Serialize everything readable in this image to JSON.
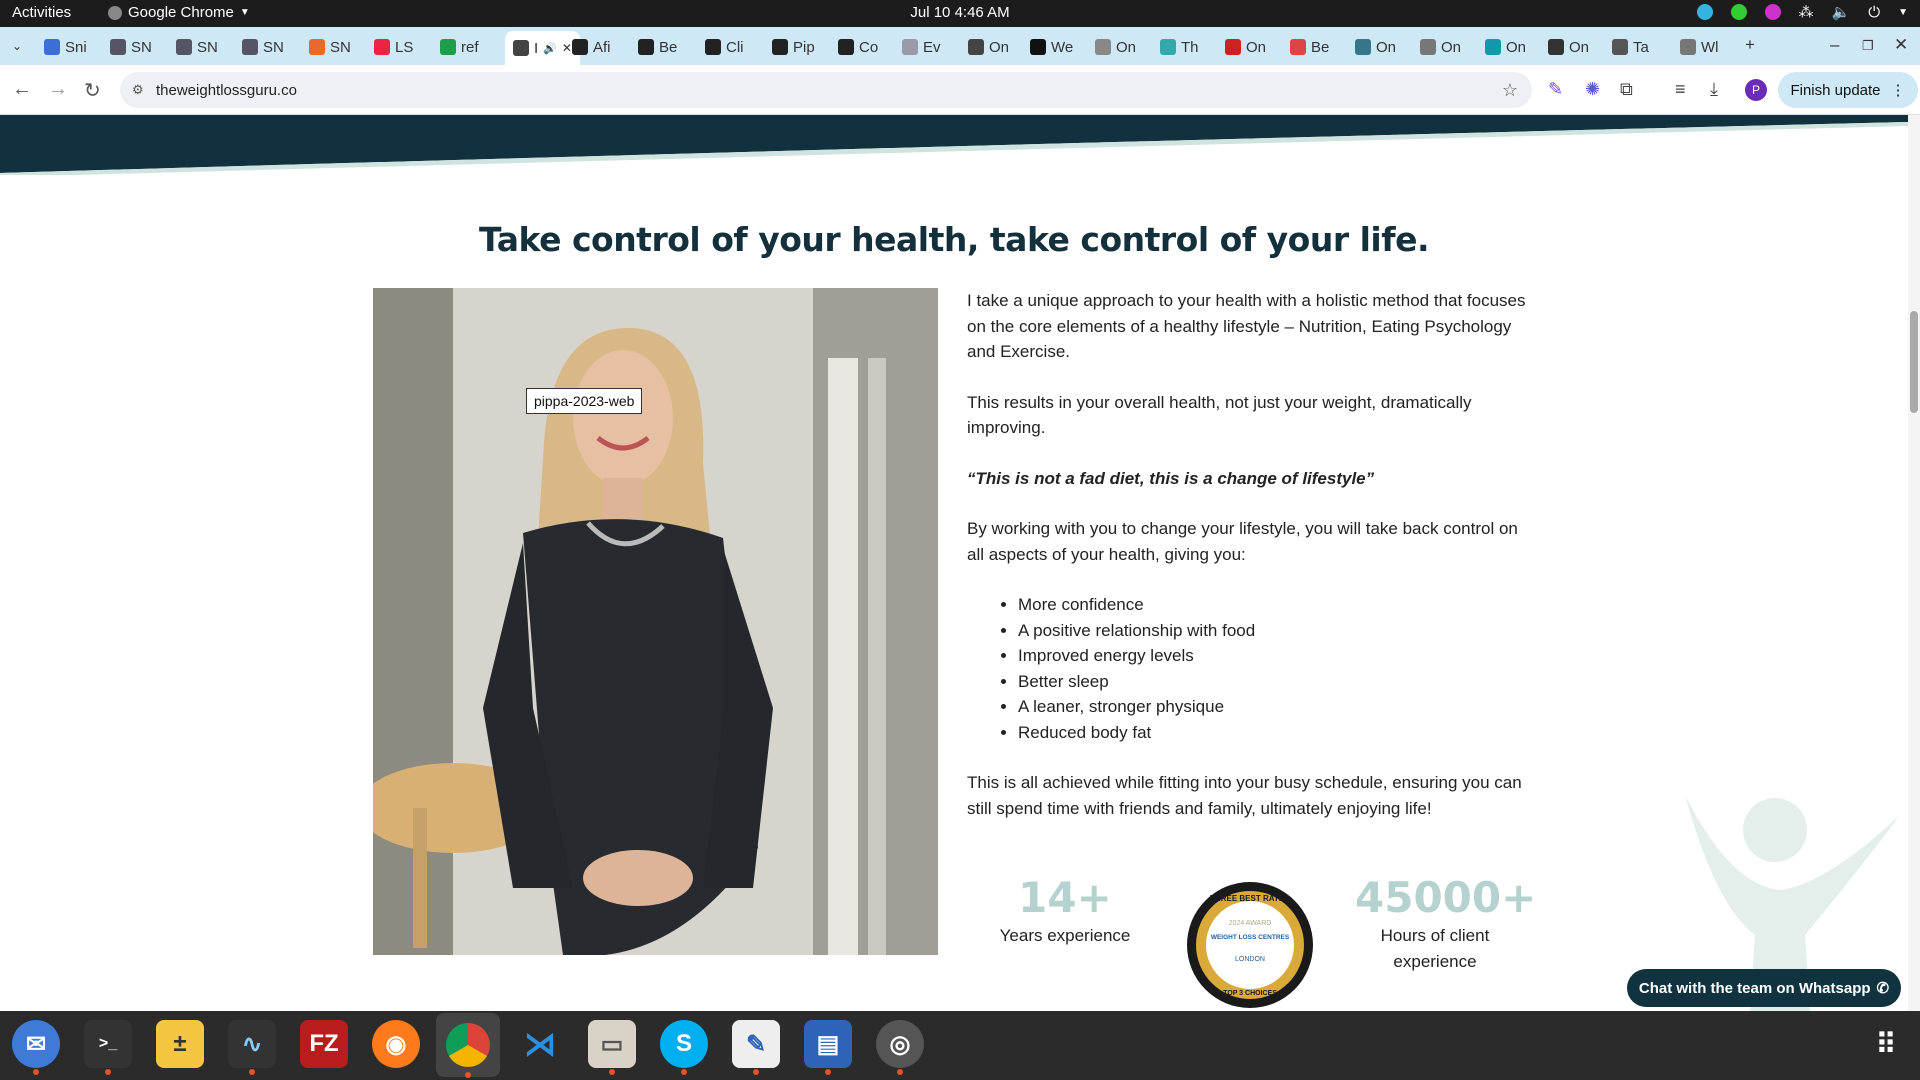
{
  "system": {
    "activities": "Activities",
    "app_name": "Google Chrome",
    "clock": "Jul 10  4:46 AM"
  },
  "tabs": [
    {
      "label": "Sni",
      "color": "#3b6fd6"
    },
    {
      "label": "SN",
      "color": "#556"
    },
    {
      "label": "SN",
      "color": "#556"
    },
    {
      "label": "SN",
      "color": "#556"
    },
    {
      "label": "SN",
      "color": "#e9682e"
    },
    {
      "label": "LS",
      "color": "#e24"
    },
    {
      "label": "ref",
      "color": "#1e9e48"
    },
    {
      "label": "I",
      "color": "#444"
    },
    {
      "label": "Afi",
      "color": "#222"
    },
    {
      "label": "Be",
      "color": "#222"
    },
    {
      "label": "Cli",
      "color": "#222"
    },
    {
      "label": "Pip",
      "color": "#222"
    },
    {
      "label": "Co",
      "color": "#222"
    },
    {
      "label": "Ev",
      "color": "#99a"
    },
    {
      "label": "On",
      "color": "#444"
    },
    {
      "label": "We",
      "color": "#111"
    },
    {
      "label": "On",
      "color": "#888"
    },
    {
      "label": "Th",
      "color": "#3aa"
    },
    {
      "label": "On",
      "color": "#c22"
    },
    {
      "label": "Be",
      "color": "#d44"
    },
    {
      "label": "On",
      "color": "#378"
    },
    {
      "label": "On",
      "color": "#777"
    },
    {
      "label": "On",
      "color": "#19a"
    },
    {
      "label": "On",
      "color": "#333"
    },
    {
      "label": "Ta",
      "color": "#555"
    },
    {
      "label": "Wl",
      "color": "#777"
    }
  ],
  "toolbar": {
    "url": "theweightlossguru.co",
    "finish_update": "Finish update"
  },
  "page": {
    "heading": "Take control of your health, take control of your life.",
    "image_tooltip": "pippa-2023-web",
    "para1": "I take a unique approach to your health with a holistic method that focuses on the core elements of a healthy lifestyle – Nutrition, Eating Psychology and Exercise.",
    "para2": "This results in your overall health, not just your weight, dramatically improving.",
    "quote": "“This is not a fad diet, this is a change of lifestyle”",
    "para3": "By working with you to change your lifestyle, you will take back control on all aspects of your health, giving you:",
    "benefits": [
      "More confidence",
      "A positive relationship with food",
      "Improved energy levels",
      "Better sleep",
      "A leaner, stronger physique",
      "Reduced body fat"
    ],
    "para4": "This is all achieved while fitting into your busy schedule, ensuring you can still spend time with friends and family, ultimately enjoying life!",
    "stat1_number": "14+",
    "stat1_label": "Years experience",
    "stat2_number": "45000+",
    "stat2_label": "Hours of client experience",
    "badge_top": "THREE BEST RATED",
    "badge_award": "2024 AWARD",
    "badge_category": "WEIGHT LOSS CENTRES",
    "badge_city": "LONDON",
    "badge_bottom": "TOP 3 CHOICES",
    "whatsapp": "Chat with the team on Whatsapp"
  },
  "colors": {
    "brand_dark": "#10333f",
    "heading": "#14303d",
    "stat_number": "#b6d2ce",
    "tab_strip": "#cfe8f6"
  }
}
